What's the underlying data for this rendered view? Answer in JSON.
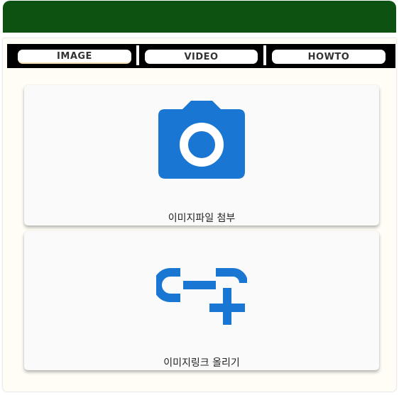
{
  "tabs": [
    {
      "label": "IMAGE",
      "active": true
    },
    {
      "label": "VIDEO",
      "active": false
    },
    {
      "label": "HOWTO",
      "active": false
    }
  ],
  "cards": [
    {
      "label": "이미지파일 첨부",
      "icon": "camera-icon"
    },
    {
      "label": "이미지링크 올리기",
      "icon": "add-link-icon"
    }
  ],
  "colors": {
    "header": "#0d5210",
    "tabbar": "#000000",
    "icon": "#1976d2",
    "panel": "#fffdf6",
    "card": "#fafafa"
  }
}
